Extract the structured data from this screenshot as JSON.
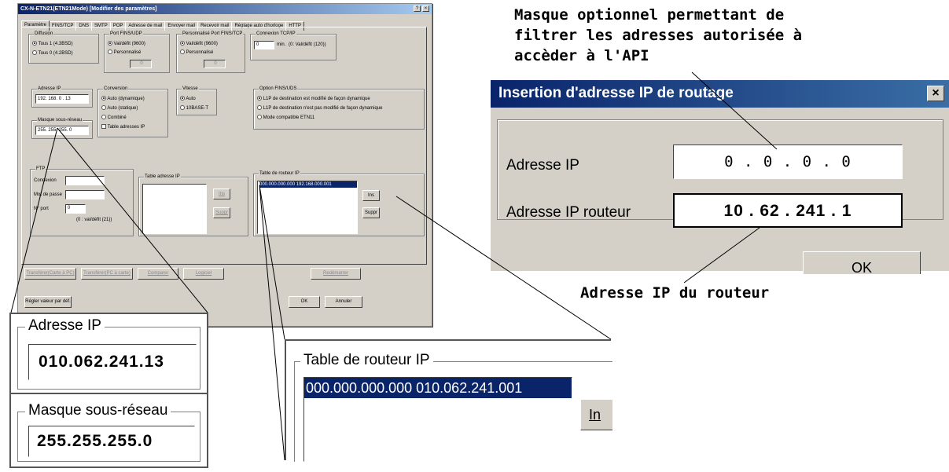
{
  "window": {
    "title": "CX-N-ETN21(ETN21Mode) [Modifier des paramètres]",
    "help": "?",
    "close": "×",
    "tabs": [
      "Paramètre",
      "FINS/TCP",
      "DNS",
      "SMTP",
      "POP",
      "Adresse de mail",
      "Envoyer mail",
      "Recevoir mail",
      "Réglage auto d'horloge",
      "HTTP"
    ],
    "diffusion": {
      "label": "Diffusion",
      "opt1": "Tous 1 (4.3BSD)",
      "opt2": "Tous 0 (4.2BSD)"
    },
    "port_fins_udp": {
      "label": "Port FINS/UDP",
      "opt1": "Val/défit (9600)",
      "opt2": "Personnalisé",
      "value": "0"
    },
    "port_fins_tcp": {
      "label": "Personnalisé Port FINS/TCP",
      "opt1": "Val/défit (9600)",
      "opt2": "Personnalisé",
      "value": "0"
    },
    "connexion_tcp": {
      "label": "Connexion TCP/IP",
      "value": "0",
      "unit": "min.",
      "hint": "(0: Val/défit (120))"
    },
    "adresse_ip": {
      "label": "Adresse IP",
      "value": "192. 168.  0 . 13"
    },
    "masque": {
      "label": "Masque sous-réseau",
      "value": "255. 255. 255.  0"
    },
    "conversion": {
      "label": "Conversion",
      "opt1": "Auto (dynamique)",
      "opt2": "Auto (statique)",
      "opt3": "Combiné",
      "opt4": "Table adresses IP"
    },
    "vitesse": {
      "label": "Vitesse",
      "opt1": "Auto",
      "opt2": "10BASE-T"
    },
    "option_fins": {
      "label": "Option FINS/UDS",
      "opt1": "L1P de destination est modifié de façon dynamique",
      "opt2": "L1P de destination n'est pas modifié de façon dynamique",
      "opt3": "Mode compatible ETN11"
    },
    "ftp": {
      "label": "FTP",
      "login": "Connexion",
      "password": "Mot de passe",
      "port_label": "N° port",
      "port_value": "0",
      "port_hint": "(0 : val/défit (21))"
    },
    "table_ip": {
      "label": "Table adresse IP",
      "ins": "Ins",
      "suppr": "Suppr"
    },
    "table_routeur": {
      "label": "Table de routeur IP",
      "row": "000.000.000.000 192.168.000.001",
      "ins": "Ins",
      "suppr": "Suppr"
    },
    "bottom_buttons": [
      "Transférer(Carte à PC)",
      "Transférer(PC à carte)",
      "Comparer",
      "Logiciel",
      "Redémarrer"
    ],
    "defaults": "Régler valeur par déf.",
    "ok": "OK",
    "cancel": "Annuler"
  },
  "zoom_ip": {
    "label": "Adresse IP",
    "value": "010.062.241.13"
  },
  "zoom_mask": {
    "label": "Masque sous-réseau",
    "value": "255.255.255.0"
  },
  "zoom_router": {
    "label": "Table de routeur IP",
    "row": "000.000.000.000  010.062.241.001",
    "btn": "In"
  },
  "dialog": {
    "title": "Insertion d'adresse IP de routage",
    "close": "×",
    "ip_label": "Adresse IP",
    "ip_value": "0   .   0   .   0   .   0",
    "router_label": "Adresse IP routeur",
    "router_value": "10 . 62 . 241 . 1",
    "ok": "OK"
  },
  "annotations": {
    "top": [
      "Masque optionnel permettant de",
      "filtrer les adresses autorisée à",
      "accèder à l'API"
    ],
    "bottom": "Adresse IP du routeur"
  }
}
